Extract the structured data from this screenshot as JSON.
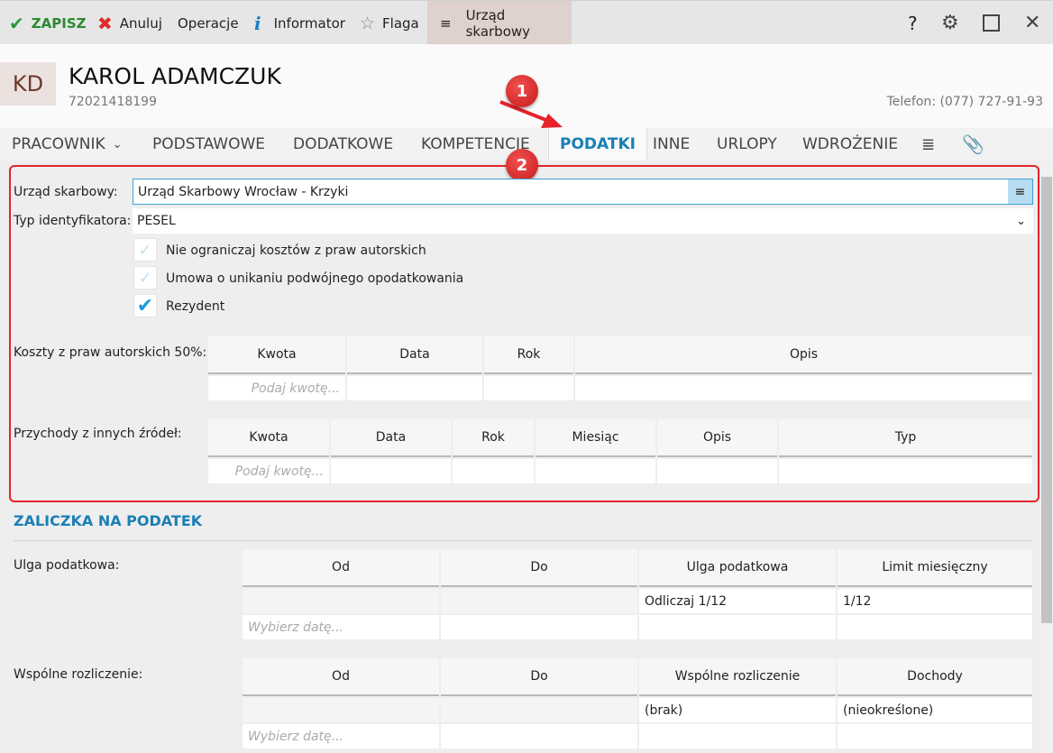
{
  "toolbar": {
    "save": "ZAPISZ",
    "cancel": "Anuluj",
    "operations": "Operacje",
    "informator": "Informator",
    "flag": "Flaga",
    "tax_office": "Urząd skarbowy"
  },
  "window": {
    "help": "?"
  },
  "employee": {
    "initials": "KD",
    "name": "KAROL ADAMCZUK",
    "pesel": "72021418199",
    "phone": "Telefon: (077) 727-91-93"
  },
  "tabs": [
    "PRACOWNIK",
    "PODSTAWOWE",
    "DODATKOWE",
    "KOMPETENCJE",
    "PODATKI",
    "INNE",
    "URLOPY",
    "WDROŻENIE"
  ],
  "annotations": {
    "one": "1",
    "two": "2"
  },
  "form": {
    "tax_office_label": "Urząd skarbowy:",
    "tax_office_value": "Urząd Skarbowy Wrocław - Krzyki",
    "id_type_label": "Typ identyfikatora:",
    "id_type_value": "PESEL",
    "checkboxes": [
      {
        "label": "Nie ograniczaj kosztów z praw autorskich",
        "checked": false
      },
      {
        "label": "Umowa o unikaniu podwójnego opodatkowania",
        "checked": false
      },
      {
        "label": "Rezydent",
        "checked": true
      }
    ],
    "costs_label": "Koszty z praw autorskich 50%:",
    "costs_headers": [
      "Kwota",
      "Data",
      "Rok",
      "Opis"
    ],
    "costs_placeholder": "Podaj kwotę...",
    "income_label": "Przychody z innych źródeł:",
    "income_headers": [
      "Kwota",
      "Data",
      "Rok",
      "Miesiąc",
      "Opis",
      "Typ"
    ],
    "income_placeholder": "Podaj kwotę..."
  },
  "advance": {
    "title": "ZALICZKA NA PODATEK",
    "relief_label": "Ulga podatkowa:",
    "relief_headers": [
      "Od",
      "Do",
      "Ulga podatkowa",
      "Limit miesięczny"
    ],
    "relief_row": [
      "",
      "",
      "Odliczaj 1/12",
      "1/12"
    ],
    "date_placeholder": "Wybierz datę...",
    "joint_label": "Wspólne rozliczenie:",
    "joint_headers": [
      "Od",
      "Do",
      "Wspólne rozliczenie",
      "Dochody"
    ],
    "joint_row": [
      "",
      "",
      "(brak)",
      "(nieokreślone)"
    ]
  }
}
